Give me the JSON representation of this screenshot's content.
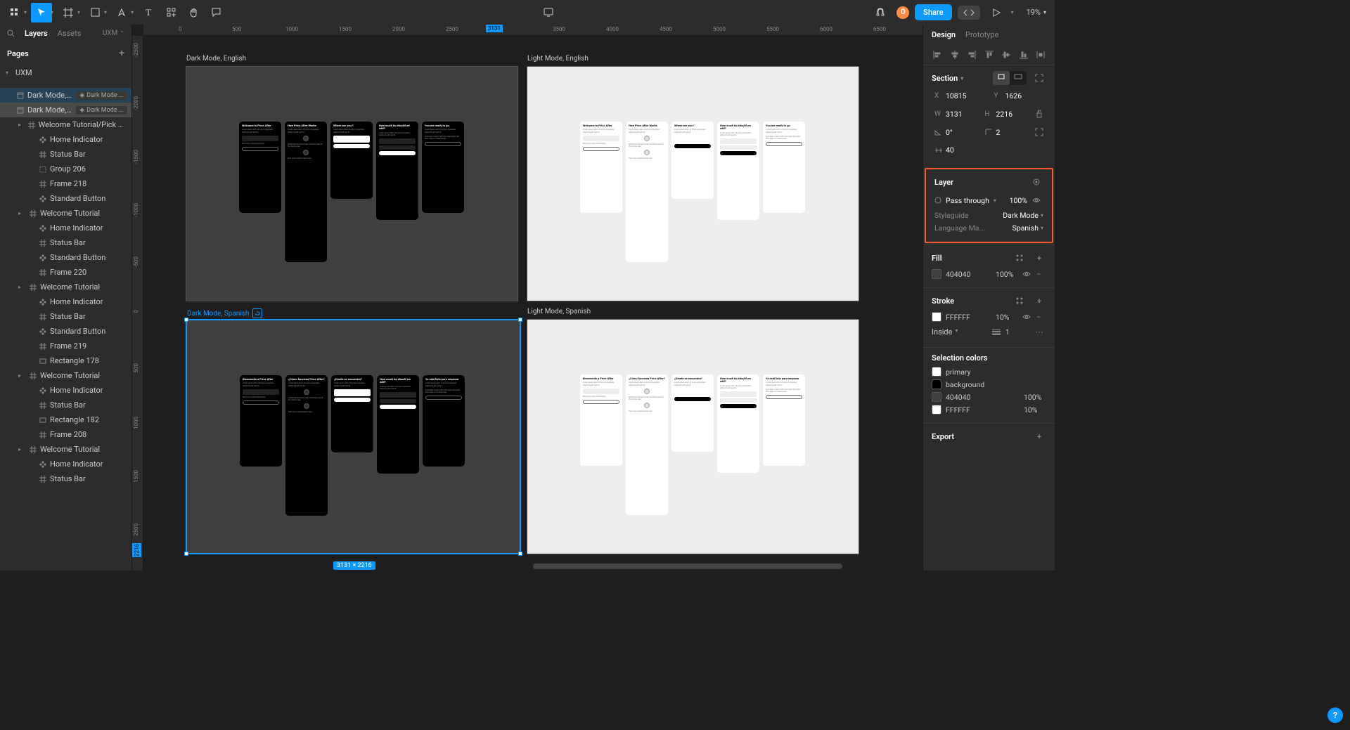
{
  "toolbar": {
    "share": "Share",
    "zoom": "19%",
    "avatar_initial": "O"
  },
  "left": {
    "tab_layers": "Layers",
    "tab_assets": "Assets",
    "project": "UXM",
    "pages_title": "Pages",
    "page_name": "UXM"
  },
  "layers": [
    {
      "depth": 0,
      "type": "section",
      "label": "Dark Mode, Spani...",
      "badge": "Dark Mode ...",
      "sel": "sel"
    },
    {
      "depth": 0,
      "type": "section",
      "label": "Dark Mode, Engli...",
      "badge": "Dark Mode ...",
      "sel": "sel2"
    },
    {
      "depth": 1,
      "type": "frame",
      "label": "Welcome Tutorial/Pick a State",
      "caret": true
    },
    {
      "depth": 2,
      "type": "comp",
      "label": "Home Indicator"
    },
    {
      "depth": 2,
      "type": "grid",
      "label": "Status Bar"
    },
    {
      "depth": 2,
      "type": "group",
      "label": "Group 206"
    },
    {
      "depth": 2,
      "type": "grid",
      "label": "Frame 218"
    },
    {
      "depth": 2,
      "type": "comp",
      "label": "Standard Button"
    },
    {
      "depth": 1,
      "type": "frame",
      "label": "Welcome Tutorial",
      "caret": true
    },
    {
      "depth": 2,
      "type": "comp",
      "label": "Home Indicator"
    },
    {
      "depth": 2,
      "type": "grid",
      "label": "Status Bar"
    },
    {
      "depth": 2,
      "type": "comp",
      "label": "Standard Button"
    },
    {
      "depth": 2,
      "type": "grid",
      "label": "Frame 220"
    },
    {
      "depth": 1,
      "type": "frame",
      "label": "Welcome Tutorial",
      "caret": true
    },
    {
      "depth": 2,
      "type": "comp",
      "label": "Home Indicator"
    },
    {
      "depth": 2,
      "type": "grid",
      "label": "Status Bar"
    },
    {
      "depth": 2,
      "type": "comp",
      "label": "Standard Button"
    },
    {
      "depth": 2,
      "type": "grid",
      "label": "Frame 219"
    },
    {
      "depth": 2,
      "type": "rect",
      "label": "Rectangle 178"
    },
    {
      "depth": 1,
      "type": "frame",
      "label": "Welcome Tutorial",
      "caret": true
    },
    {
      "depth": 2,
      "type": "comp",
      "label": "Home Indicator"
    },
    {
      "depth": 2,
      "type": "grid",
      "label": "Status Bar"
    },
    {
      "depth": 2,
      "type": "rect",
      "label": "Rectangle 182"
    },
    {
      "depth": 2,
      "type": "grid",
      "label": "Frame 208"
    },
    {
      "depth": 1,
      "type": "frame",
      "label": "Welcome Tutorial",
      "caret": true
    },
    {
      "depth": 2,
      "type": "comp",
      "label": "Home Indicator"
    },
    {
      "depth": 2,
      "type": "grid",
      "label": "Status Bar"
    }
  ],
  "canvas": {
    "ruler_h": [
      "0",
      "500",
      "1000",
      "1500",
      "2000",
      "2500",
      "",
      "3500",
      "4000",
      "4500",
      "5000",
      "5500",
      "6000",
      "6500"
    ],
    "ruler_marker": "3131",
    "ruler_v": [
      "-2500",
      "-2000",
      "-1500",
      "-1000",
      "-500",
      "0",
      "500",
      "1000",
      "1500",
      "2500"
    ],
    "ruler_v_marker": "2216",
    "sections": {
      "dm_en": "Dark Mode, English",
      "lm_en": "Light Mode, English",
      "dm_es": "Dark Mode, Spanish",
      "lm_es": "Light Mode, Spanish"
    },
    "phone_titles_en": [
      "Welcome to Price After",
      "How Price After Works",
      "Where are you ?",
      "How much tip should we add?",
      "You are ready to go."
    ],
    "phone_titles_es": [
      "Bienvenido a Price After",
      "¿Cómo funciona Price After?",
      "¿Dónde se encuentra?",
      "How much tip should we add?",
      "Ya está listo para empezar"
    ],
    "dim_label": "3131 × 2216"
  },
  "right": {
    "tab_design": "Design",
    "tab_prototype": "Prototype",
    "section_label": "Section",
    "props": {
      "x_label": "X",
      "x": "10815",
      "y_label": "Y",
      "y": "1626",
      "w_label": "W",
      "w": "3131",
      "h_label": "H",
      "h": "2216",
      "rot": "0°",
      "corner": "2",
      "clip": "40"
    },
    "layer_panel": {
      "title": "Layer",
      "blend": "Pass through",
      "opacity": "100%",
      "styleguide_k": "Styleguide",
      "styleguide_v": "Dark Mode",
      "lang_k": "Language Ma...",
      "lang_v": "Spanish"
    },
    "fill": {
      "title": "Fill",
      "hex": "404040",
      "pct": "100%"
    },
    "stroke": {
      "title": "Stroke",
      "hex": "FFFFFF",
      "pct": "10%",
      "pos": "Inside",
      "weight": "1"
    },
    "sel_colors": {
      "title": "Selection colors",
      "items": [
        {
          "hex": "primary",
          "swatch": "#ffffff"
        },
        {
          "hex": "background",
          "swatch": "#000000"
        },
        {
          "hex": "404040",
          "swatch": "#404040",
          "pct": "100%"
        },
        {
          "hex": "FFFFFF",
          "swatch": "#ffffff",
          "pct": "10%"
        }
      ]
    },
    "export": "Export"
  }
}
